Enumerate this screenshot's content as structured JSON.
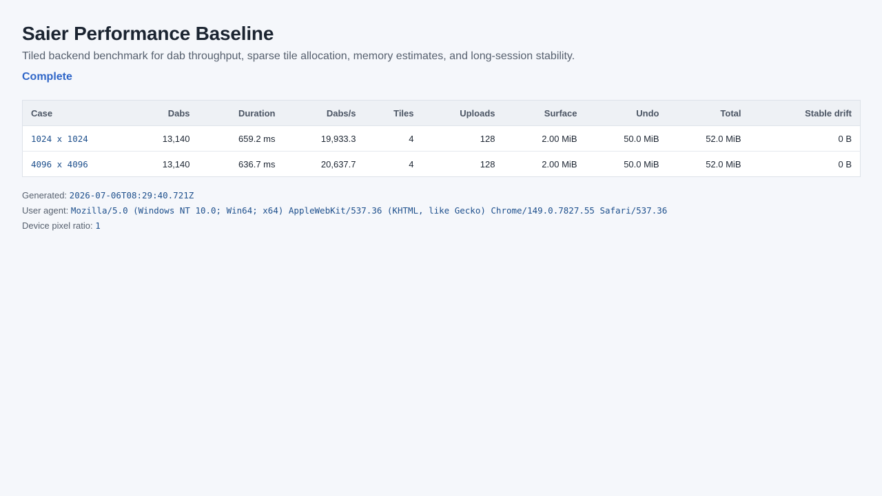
{
  "header": {
    "title": "Saier Performance Baseline",
    "subtitle": "Tiled backend benchmark for dab throughput, sparse tile allocation, memory estimates, and long-session stability.",
    "status": "Complete",
    "status_color": "#2f66c8"
  },
  "table": {
    "columns": [
      "Case",
      "Dabs",
      "Duration",
      "Dabs/s",
      "Tiles",
      "Uploads",
      "Surface",
      "Undo",
      "Total",
      "Stable drift"
    ],
    "rows": [
      [
        "1024 x 1024",
        "13,140",
        "659.2 ms",
        "19,933.3",
        "4",
        "128",
        "2.00 MiB",
        "50.0 MiB",
        "52.0 MiB",
        "0 B"
      ],
      [
        "4096 x 4096",
        "13,140",
        "636.7 ms",
        "20,637.7",
        "4",
        "128",
        "2.00 MiB",
        "50.0 MiB",
        "52.0 MiB",
        "0 B"
      ]
    ]
  },
  "meta": {
    "generated_label": "Generated:",
    "generated_value": "2026-07-06T08:29:40.721Z",
    "user_agent_label": "User agent:",
    "user_agent_value": "Mozilla/5.0 (Windows NT 10.0; Win64; x64) AppleWebKit/537.36 (KHTML, like Gecko) Chrome/149.0.7827.55 Safari/537.36",
    "dpr_label": "Device pixel ratio:",
    "dpr_value": "1"
  }
}
